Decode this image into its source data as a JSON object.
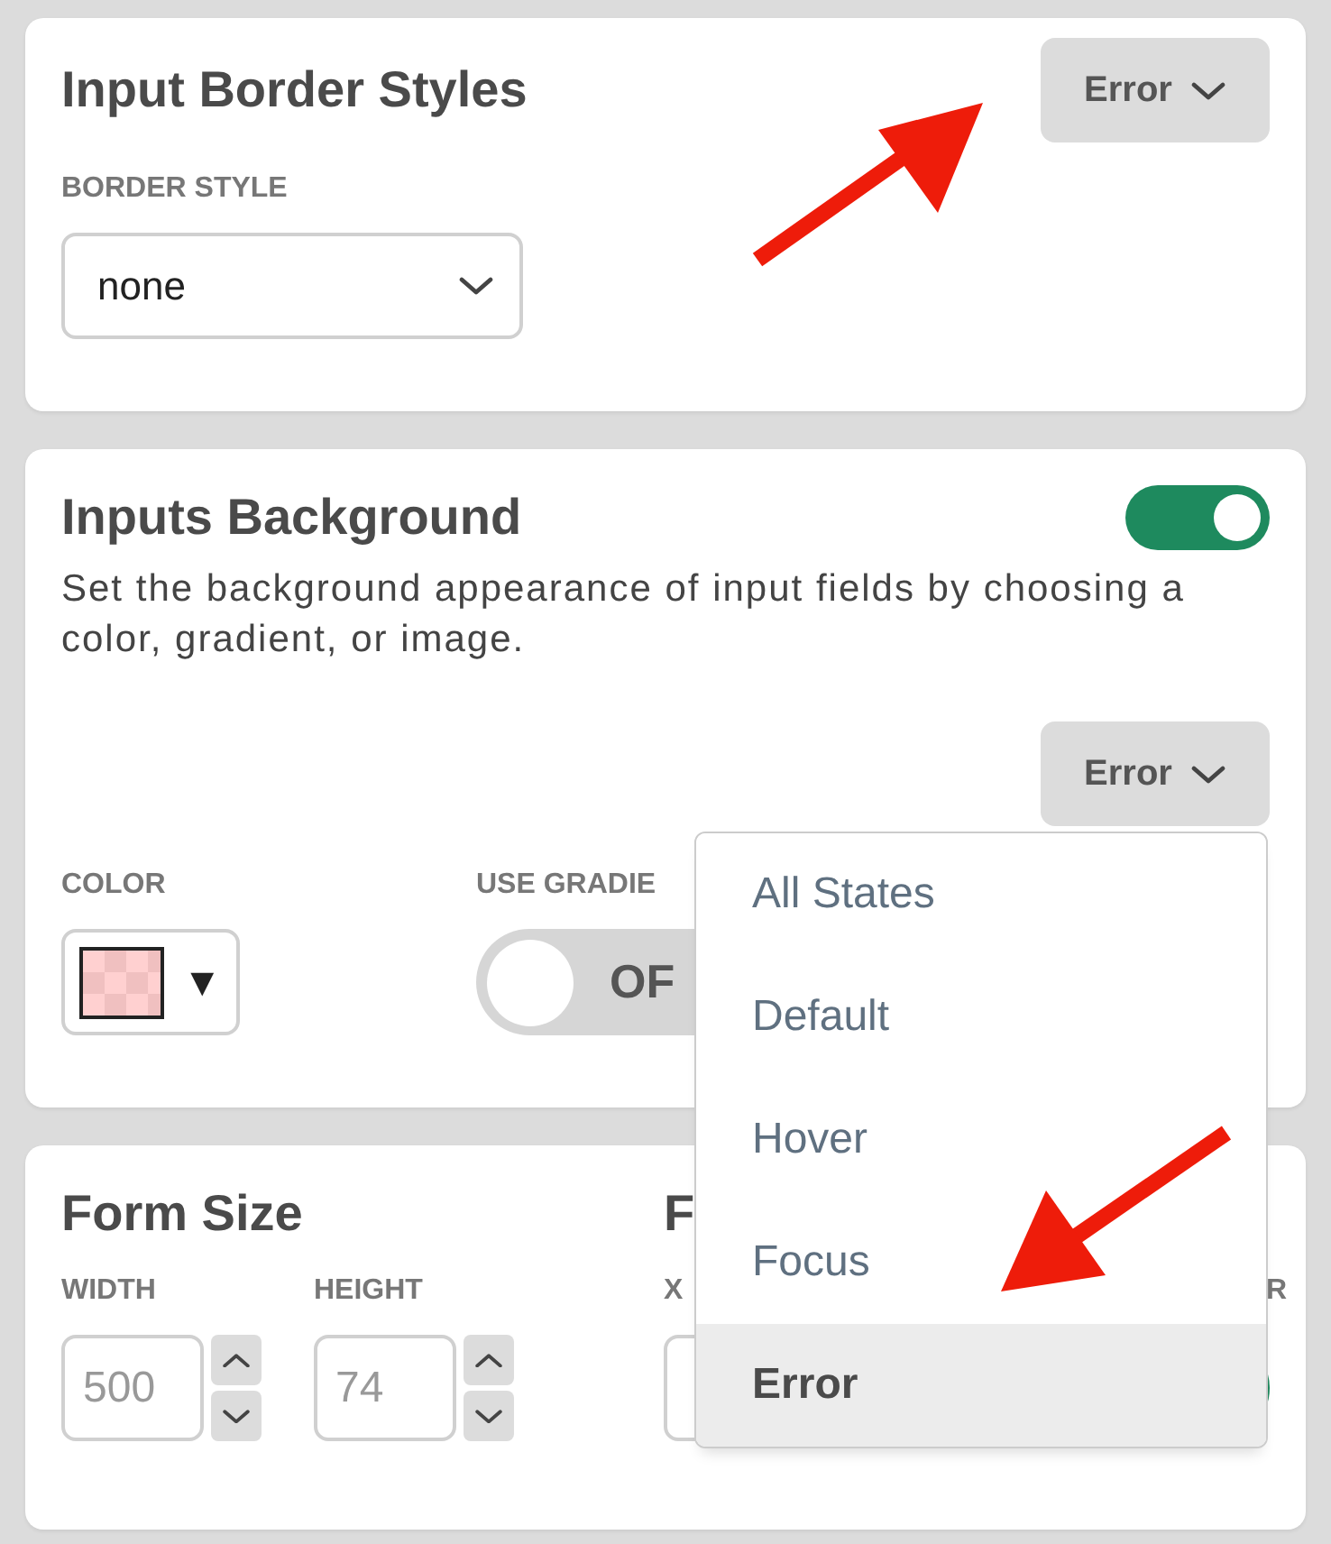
{
  "border_card": {
    "title": "Input Border Styles",
    "state_button": "Error",
    "label": "BORDER STYLE",
    "select_value": "none"
  },
  "background_card": {
    "title": "Inputs Background",
    "enabled": true,
    "description": "Set the background appearance of input fields by choosing a color, gradient, or image.",
    "state_button": "Error",
    "color_label": "COLOR",
    "swatch_arrow": "▼",
    "gradient_label": "USE GRADIE",
    "gradient_toggle": {
      "on": false,
      "label": "OF"
    }
  },
  "size_card": {
    "title": "Form Size",
    "fields": [
      {
        "label": "WIDTH",
        "value": "500"
      },
      {
        "label": "HEIGHT",
        "value": "74"
      }
    ],
    "second_title": "F",
    "second_field": {
      "label": "X"
    },
    "third_label": "R",
    "third_toggle": {
      "on": true
    }
  },
  "state_menu": {
    "items": [
      {
        "label": "All States",
        "selected": false
      },
      {
        "label": "Default",
        "selected": false
      },
      {
        "label": "Hover",
        "selected": false
      },
      {
        "label": "Focus",
        "selected": false
      },
      {
        "label": "Error",
        "selected": true
      }
    ]
  }
}
